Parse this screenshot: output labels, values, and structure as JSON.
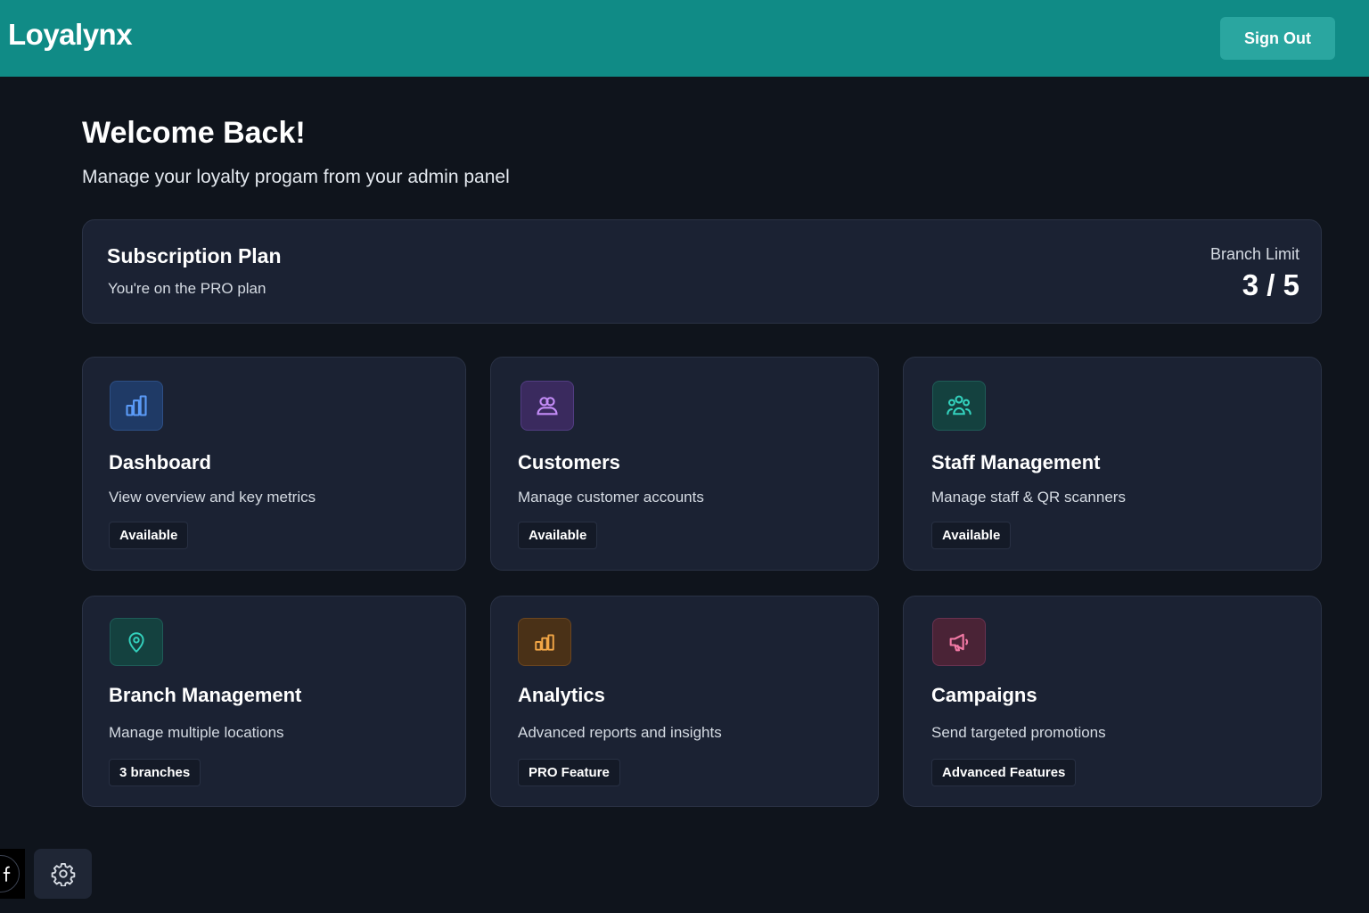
{
  "header": {
    "brand": "Loyalynx",
    "sign_out_label": "Sign Out"
  },
  "welcome": {
    "title": "Welcome Back!",
    "subtitle": "Manage your loyalty progam from your admin panel"
  },
  "subscription": {
    "title": "Subscription Plan",
    "description": "You're on the PRO plan",
    "limit_label": "Branch Limit",
    "limit_value": "3 / 5"
  },
  "cards": [
    {
      "icon": "bar-chart-icon",
      "title": "Dashboard",
      "description": "View overview and key metrics",
      "badge": "Available",
      "accent": "#4b8df6"
    },
    {
      "icon": "users-icon",
      "title": "Customers",
      "description": "Manage customer accounts",
      "badge": "Available",
      "accent": "#b077f5"
    },
    {
      "icon": "team-icon",
      "title": "Staff Management",
      "description": "Manage staff & QR scanners",
      "badge": "Available",
      "accent": "#2cc8b4"
    },
    {
      "icon": "map-pin-icon",
      "title": "Branch Management",
      "description": "Manage multiple locations",
      "badge": "3 branches",
      "accent": "#2cc8b4"
    },
    {
      "icon": "analytics-icon",
      "title": "Analytics",
      "description": "Advanced reports and insights",
      "badge": "PRO Feature",
      "accent": "#f0a341"
    },
    {
      "icon": "megaphone-icon",
      "title": "Campaigns",
      "description": "Send targeted promotions",
      "badge": "Advanced Features",
      "accent": "#f06a9b"
    }
  ],
  "colors": {
    "header_bg": "#108b86",
    "page_bg": "#0f141c",
    "card_bg": "#1b2233"
  }
}
